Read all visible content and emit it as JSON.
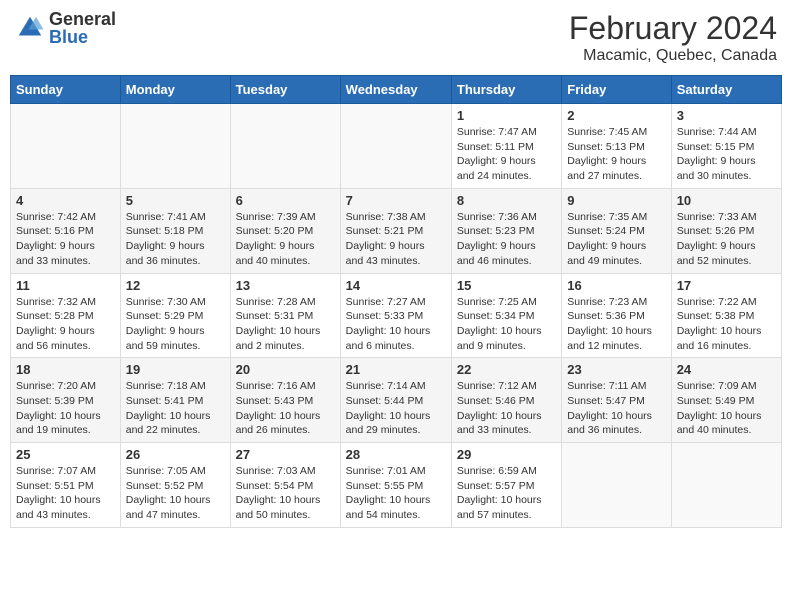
{
  "header": {
    "logo_general": "General",
    "logo_blue": "Blue",
    "month_year": "February 2024",
    "location": "Macamic, Quebec, Canada"
  },
  "weekdays": [
    "Sunday",
    "Monday",
    "Tuesday",
    "Wednesday",
    "Thursday",
    "Friday",
    "Saturday"
  ],
  "weeks": [
    [
      {
        "day": "",
        "info": ""
      },
      {
        "day": "",
        "info": ""
      },
      {
        "day": "",
        "info": ""
      },
      {
        "day": "",
        "info": ""
      },
      {
        "day": "1",
        "info": "Sunrise: 7:47 AM\nSunset: 5:11 PM\nDaylight: 9 hours\nand 24 minutes."
      },
      {
        "day": "2",
        "info": "Sunrise: 7:45 AM\nSunset: 5:13 PM\nDaylight: 9 hours\nand 27 minutes."
      },
      {
        "day": "3",
        "info": "Sunrise: 7:44 AM\nSunset: 5:15 PM\nDaylight: 9 hours\nand 30 minutes."
      }
    ],
    [
      {
        "day": "4",
        "info": "Sunrise: 7:42 AM\nSunset: 5:16 PM\nDaylight: 9 hours\nand 33 minutes."
      },
      {
        "day": "5",
        "info": "Sunrise: 7:41 AM\nSunset: 5:18 PM\nDaylight: 9 hours\nand 36 minutes."
      },
      {
        "day": "6",
        "info": "Sunrise: 7:39 AM\nSunset: 5:20 PM\nDaylight: 9 hours\nand 40 minutes."
      },
      {
        "day": "7",
        "info": "Sunrise: 7:38 AM\nSunset: 5:21 PM\nDaylight: 9 hours\nand 43 minutes."
      },
      {
        "day": "8",
        "info": "Sunrise: 7:36 AM\nSunset: 5:23 PM\nDaylight: 9 hours\nand 46 minutes."
      },
      {
        "day": "9",
        "info": "Sunrise: 7:35 AM\nSunset: 5:24 PM\nDaylight: 9 hours\nand 49 minutes."
      },
      {
        "day": "10",
        "info": "Sunrise: 7:33 AM\nSunset: 5:26 PM\nDaylight: 9 hours\nand 52 minutes."
      }
    ],
    [
      {
        "day": "11",
        "info": "Sunrise: 7:32 AM\nSunset: 5:28 PM\nDaylight: 9 hours\nand 56 minutes."
      },
      {
        "day": "12",
        "info": "Sunrise: 7:30 AM\nSunset: 5:29 PM\nDaylight: 9 hours\nand 59 minutes."
      },
      {
        "day": "13",
        "info": "Sunrise: 7:28 AM\nSunset: 5:31 PM\nDaylight: 10 hours\nand 2 minutes."
      },
      {
        "day": "14",
        "info": "Sunrise: 7:27 AM\nSunset: 5:33 PM\nDaylight: 10 hours\nand 6 minutes."
      },
      {
        "day": "15",
        "info": "Sunrise: 7:25 AM\nSunset: 5:34 PM\nDaylight: 10 hours\nand 9 minutes."
      },
      {
        "day": "16",
        "info": "Sunrise: 7:23 AM\nSunset: 5:36 PM\nDaylight: 10 hours\nand 12 minutes."
      },
      {
        "day": "17",
        "info": "Sunrise: 7:22 AM\nSunset: 5:38 PM\nDaylight: 10 hours\nand 16 minutes."
      }
    ],
    [
      {
        "day": "18",
        "info": "Sunrise: 7:20 AM\nSunset: 5:39 PM\nDaylight: 10 hours\nand 19 minutes."
      },
      {
        "day": "19",
        "info": "Sunrise: 7:18 AM\nSunset: 5:41 PM\nDaylight: 10 hours\nand 22 minutes."
      },
      {
        "day": "20",
        "info": "Sunrise: 7:16 AM\nSunset: 5:43 PM\nDaylight: 10 hours\nand 26 minutes."
      },
      {
        "day": "21",
        "info": "Sunrise: 7:14 AM\nSunset: 5:44 PM\nDaylight: 10 hours\nand 29 minutes."
      },
      {
        "day": "22",
        "info": "Sunrise: 7:12 AM\nSunset: 5:46 PM\nDaylight: 10 hours\nand 33 minutes."
      },
      {
        "day": "23",
        "info": "Sunrise: 7:11 AM\nSunset: 5:47 PM\nDaylight: 10 hours\nand 36 minutes."
      },
      {
        "day": "24",
        "info": "Sunrise: 7:09 AM\nSunset: 5:49 PM\nDaylight: 10 hours\nand 40 minutes."
      }
    ],
    [
      {
        "day": "25",
        "info": "Sunrise: 7:07 AM\nSunset: 5:51 PM\nDaylight: 10 hours\nand 43 minutes."
      },
      {
        "day": "26",
        "info": "Sunrise: 7:05 AM\nSunset: 5:52 PM\nDaylight: 10 hours\nand 47 minutes."
      },
      {
        "day": "27",
        "info": "Sunrise: 7:03 AM\nSunset: 5:54 PM\nDaylight: 10 hours\nand 50 minutes."
      },
      {
        "day": "28",
        "info": "Sunrise: 7:01 AM\nSunset: 5:55 PM\nDaylight: 10 hours\nand 54 minutes."
      },
      {
        "day": "29",
        "info": "Sunrise: 6:59 AM\nSunset: 5:57 PM\nDaylight: 10 hours\nand 57 minutes."
      },
      {
        "day": "",
        "info": ""
      },
      {
        "day": "",
        "info": ""
      }
    ]
  ]
}
